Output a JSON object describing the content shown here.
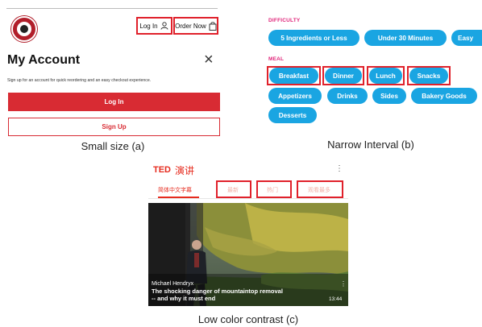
{
  "panel_a": {
    "header": {
      "login_label": "Log In",
      "order_label": "Order Now"
    },
    "title": "My Account",
    "close_glyph": "×",
    "description": "Sign up for an account for quick reordering and an easy checkout experience.",
    "login_button": "Log In",
    "signup_button": "Sign Up",
    "caption": "Small size (a)",
    "icons": [
      "panera-logo-icon",
      "user-icon",
      "shopping-bag-icon",
      "close-icon"
    ]
  },
  "panel_b": {
    "difficulty_label": "DIFFICULTY",
    "difficulty_pills": [
      "5 Ingredients or Less",
      "Under 30 Minutes",
      "Easy"
    ],
    "meal_label": "MEAL",
    "meal_row1": [
      "Breakfast",
      "Dinner",
      "Lunch",
      "Snacks"
    ],
    "meal_row2": [
      "Appetizers",
      "Drinks",
      "Sides",
      "Bakery Goods"
    ],
    "meal_row3": [
      "Desserts"
    ],
    "caption": "Narrow Interval (b)",
    "colors": {
      "pill": "#1aa5e2",
      "label": "#e0257a"
    }
  },
  "panel_c": {
    "logo": "TED",
    "logo_sub": "演讲",
    "menu_glyph": "⋮",
    "tabs": [
      "简体中文字幕",
      "最新",
      "热门",
      "观看最多"
    ],
    "video": {
      "speaker": "Michael Hendryx",
      "title_line1": "The shocking danger of mountaintop removal",
      "title_line2": "-- and why it must end",
      "duration": "13:44",
      "menu_glyph": "⋮"
    },
    "caption": "Low color contrast (c)",
    "colors": {
      "accent": "#e62b1e"
    }
  }
}
